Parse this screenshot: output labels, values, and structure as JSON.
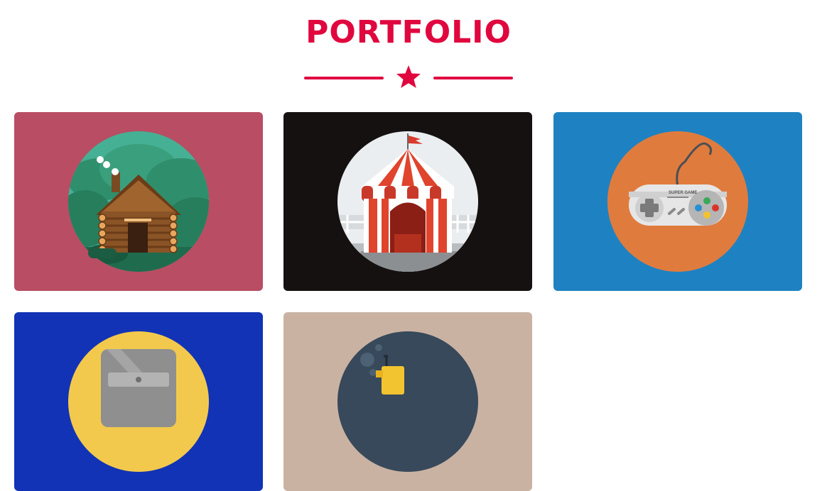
{
  "section": {
    "title": "PORTFOLIO"
  },
  "colors": {
    "accent": "#e0073f",
    "card_cabin_bg": "#b84d63",
    "card_circus_bg": "#141110",
    "card_controller_bg": "#1e82c2",
    "card_safe_bg": "#1233b5",
    "card_submarine_bg": "#cab2a3"
  },
  "portfolio_items": [
    {
      "icon": "log-cabin-icon"
    },
    {
      "icon": "circus-tent-icon"
    },
    {
      "icon": "game-controller-icon"
    },
    {
      "icon": "safe-icon"
    },
    {
      "icon": "submarine-icon"
    }
  ],
  "controller_label": "SUPER GAME"
}
